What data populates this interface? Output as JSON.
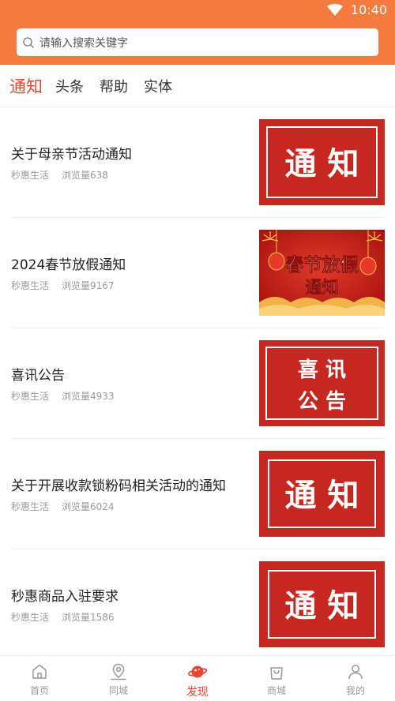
{
  "status_bar": {
    "time": "10:40"
  },
  "search": {
    "placeholder": "请输入搜索关键字"
  },
  "tabs": [
    {
      "label": "通知",
      "active": true
    },
    {
      "label": "头条",
      "active": false
    },
    {
      "label": "帮助",
      "active": false
    },
    {
      "label": "实体",
      "active": false
    }
  ],
  "articles": [
    {
      "title": "关于母亲节活动通知",
      "source": "秒惠生活",
      "views": "浏览量638",
      "thumb": {
        "kind": "notice",
        "text": "通 知"
      }
    },
    {
      "title": "2024春节放假通知",
      "source": "秒惠生活",
      "views": "浏览量9167",
      "thumb": {
        "kind": "festival",
        "line1": "春节放假",
        "line2": "通知"
      }
    },
    {
      "title": "喜讯公告",
      "source": "秒惠生活",
      "views": "浏览量4933",
      "thumb": {
        "kind": "announce",
        "line1": "喜 讯",
        "line2": "公 告"
      }
    },
    {
      "title": "关于开展收款锁粉码相关活动的通知",
      "source": "秒惠生活",
      "views": "浏览量6024",
      "thumb": {
        "kind": "notice",
        "text": "通 知"
      }
    },
    {
      "title": "秒惠商品入驻要求",
      "source": "秒惠生活",
      "views": "浏览量1586",
      "thumb": {
        "kind": "notice",
        "text": "通 知"
      }
    }
  ],
  "bottom_nav": [
    {
      "label": "首页",
      "icon": "home-icon",
      "active": false
    },
    {
      "label": "同城",
      "icon": "location-icon",
      "active": false
    },
    {
      "label": "发现",
      "icon": "planet-icon",
      "active": true
    },
    {
      "label": "商城",
      "icon": "shopping-bag-icon",
      "active": false
    },
    {
      "label": "我的",
      "icon": "user-icon",
      "active": false
    }
  ],
  "colors": {
    "header": "#f47b3f",
    "accent": "#e8442f",
    "notice_red": "#c62821"
  }
}
